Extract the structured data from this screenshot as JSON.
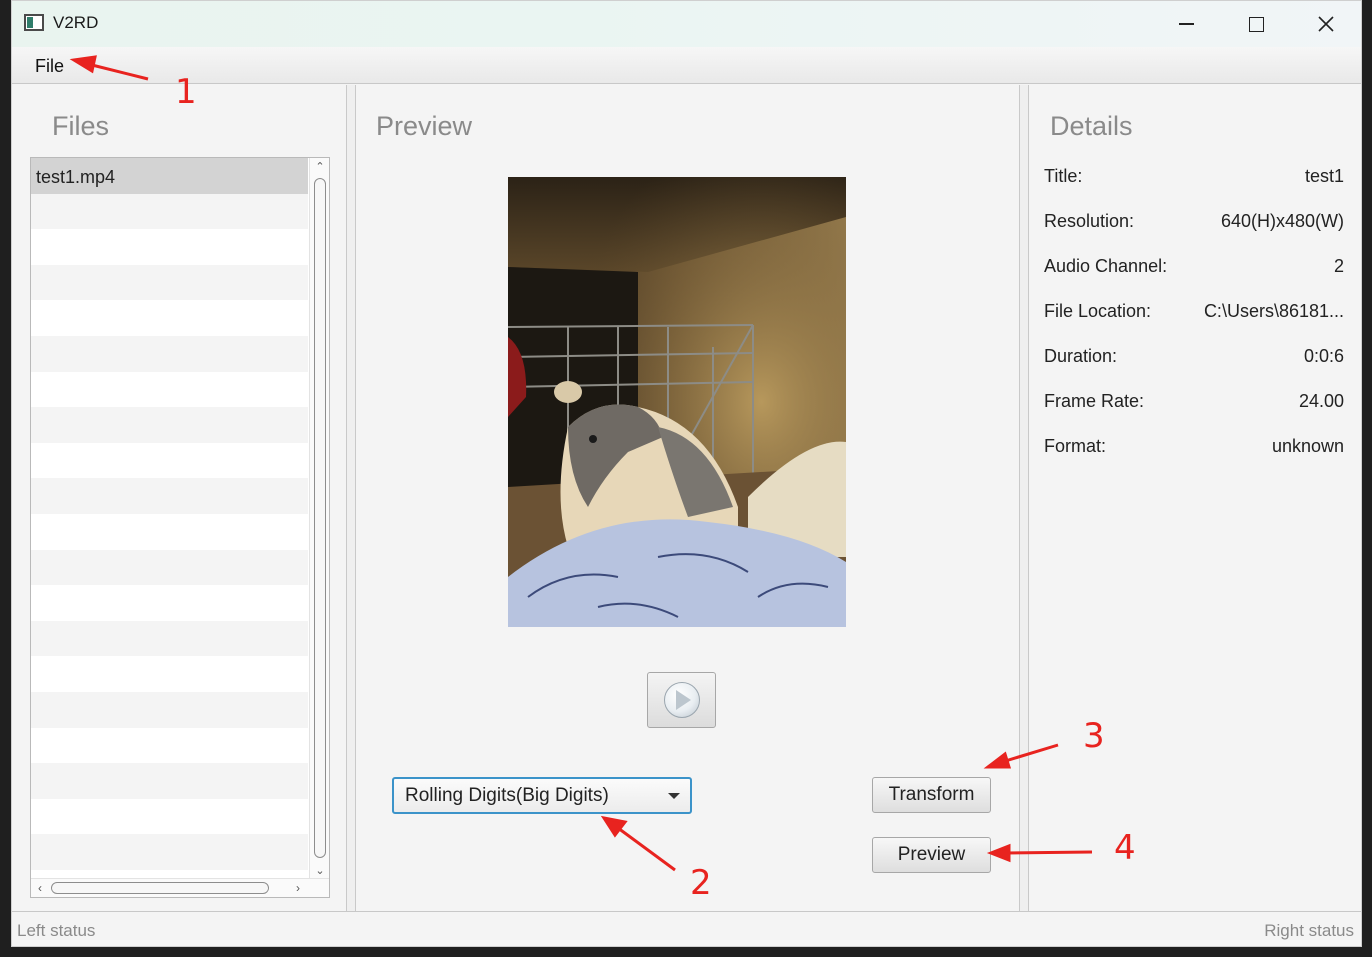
{
  "window": {
    "title": "V2RD",
    "controls": {
      "minimize": "minimize",
      "maximize": "maximize",
      "close": "close"
    }
  },
  "menu": {
    "items": [
      {
        "label": "File"
      }
    ]
  },
  "files_panel": {
    "heading": "Files",
    "items": [
      {
        "name": "test1.mp4",
        "selected": true
      }
    ]
  },
  "preview_panel": {
    "heading": "Preview",
    "play_icon": "play-icon",
    "mode_select": {
      "selected": "Rolling Digits(Big Digits)"
    },
    "transform_label": "Transform",
    "preview_label": "Preview"
  },
  "details_panel": {
    "heading": "Details",
    "rows": [
      {
        "label": "Title:",
        "value": "test1"
      },
      {
        "label": "Resolution:",
        "value": "640(H)x480(W)"
      },
      {
        "label": "Audio Channel:",
        "value": "2"
      },
      {
        "label": "File Location:",
        "value": "C:\\Users\\86181..."
      },
      {
        "label": "Duration:",
        "value": "0:0:6"
      },
      {
        "label": "Frame Rate:",
        "value": "24.00"
      },
      {
        "label": "Format:",
        "value": "unknown"
      }
    ]
  },
  "status": {
    "left": "Left status",
    "right": "Right status"
  },
  "annotations": {
    "n1": "1",
    "n2": "2",
    "n3": "3",
    "n4": "4",
    "color": "#e8231f"
  },
  "colors": {
    "select_border": "#3b93c9",
    "heading": "#8a8a8a"
  }
}
